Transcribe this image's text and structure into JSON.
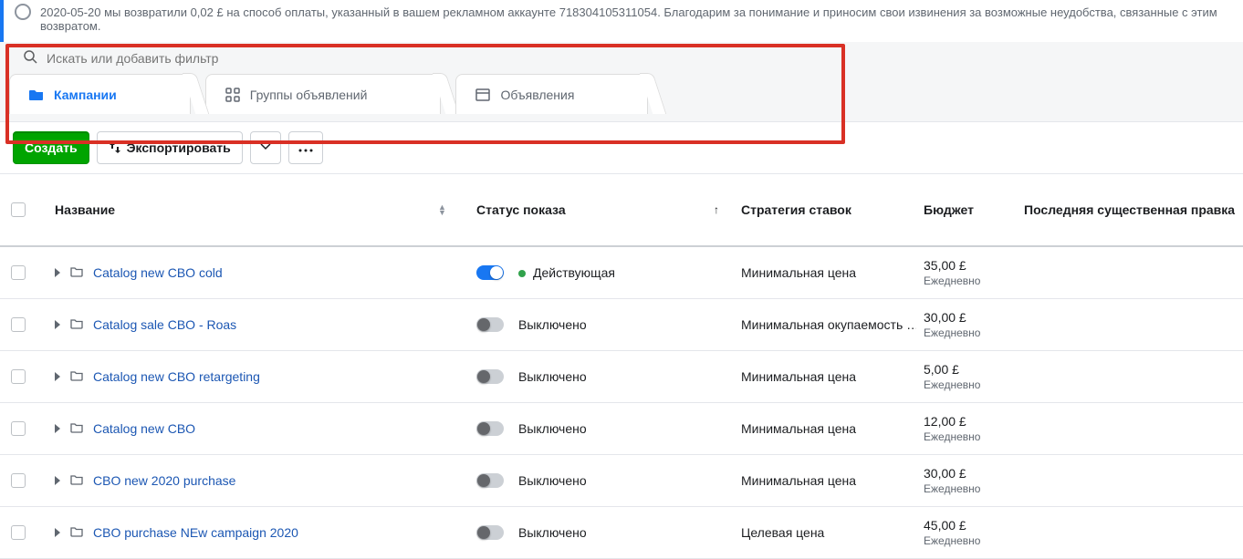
{
  "banner": {
    "text": "2020-05-20 мы возвратили 0,02 £ на способ оплаты, указанный в вашем рекламном аккаунте 718304105311054. Благодарим за понимание и приносим свои извинения за возможные неудобства, связанные с этим возвратом."
  },
  "search": {
    "placeholder": "Искать или добавить фильтр"
  },
  "tabs": {
    "campaigns": "Кампании",
    "adsets": "Группы объявлений",
    "ads": "Объявления"
  },
  "toolbar": {
    "create": "Создать",
    "export": "Экспортировать"
  },
  "columns": {
    "name": "Название",
    "delivery": "Статус показа",
    "bid_strategy": "Стратегия ставок",
    "budget": "Бюджет",
    "last_edit": "Последняя существенная правка"
  },
  "status": {
    "active": "Действующая",
    "off": "Выключено"
  },
  "budget_period": "Ежедневно",
  "rows": [
    {
      "name": "Catalog new CBO cold",
      "on": true,
      "status": "active",
      "bid": "Минимальная цена",
      "budget": "35,00 £"
    },
    {
      "name": "Catalog sale CBO - Roas",
      "on": false,
      "status": "off",
      "bid": "Минимальная окупаемость …",
      "budget": "30,00 £"
    },
    {
      "name": "Catalog new CBO retargeting",
      "on": false,
      "status": "off",
      "bid": "Минимальная цена",
      "budget": "5,00 £"
    },
    {
      "name": "Catalog new CBO",
      "on": false,
      "status": "off",
      "bid": "Минимальная цена",
      "budget": "12,00 £"
    },
    {
      "name": "CBO new 2020 purchase",
      "on": false,
      "status": "off",
      "bid": "Минимальная цена",
      "budget": "30,00 £"
    },
    {
      "name": "CBO purchase NEw campaign 2020",
      "on": false,
      "status": "off",
      "bid": "Целевая цена",
      "budget": "45,00 £"
    }
  ]
}
